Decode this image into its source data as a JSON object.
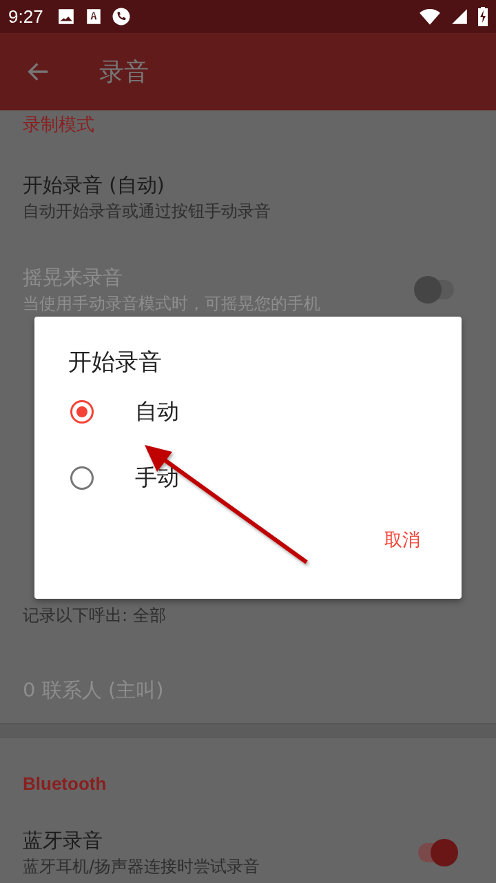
{
  "status_bar": {
    "time": "9:27"
  },
  "app_bar": {
    "title": "录音"
  },
  "upper": [
    {
      "kind": "category",
      "title": "录制模式"
    },
    {
      "kind": "item",
      "title": "开始录音 (自动)",
      "summary": "自动开始录音或通过按钮手动录音",
      "disabled": false
    },
    {
      "kind": "switch",
      "title": "摇晃来录音",
      "summary": "当使用手动录音模式时，可摇晃您的手机",
      "disabled": true,
      "on": false
    }
  ],
  "lower": [
    {
      "kind": "summary",
      "summary": "记录以下呼出: 全部",
      "disabled": false
    },
    {
      "kind": "item",
      "title": "0 联系人 (主叫)",
      "disabled": true
    },
    {
      "kind": "divider"
    },
    {
      "kind": "category",
      "title": "Bluetooth"
    },
    {
      "kind": "switch",
      "title": "蓝牙录音",
      "summary": "蓝牙耳机/扬声器连接时尝试录音",
      "disabled": false,
      "on": true
    }
  ],
  "dialog": {
    "title": "开始录音",
    "options": [
      {
        "label": "自动",
        "selected": true
      },
      {
        "label": "手动",
        "selected": false
      }
    ],
    "buttons": [
      "取消"
    ]
  }
}
